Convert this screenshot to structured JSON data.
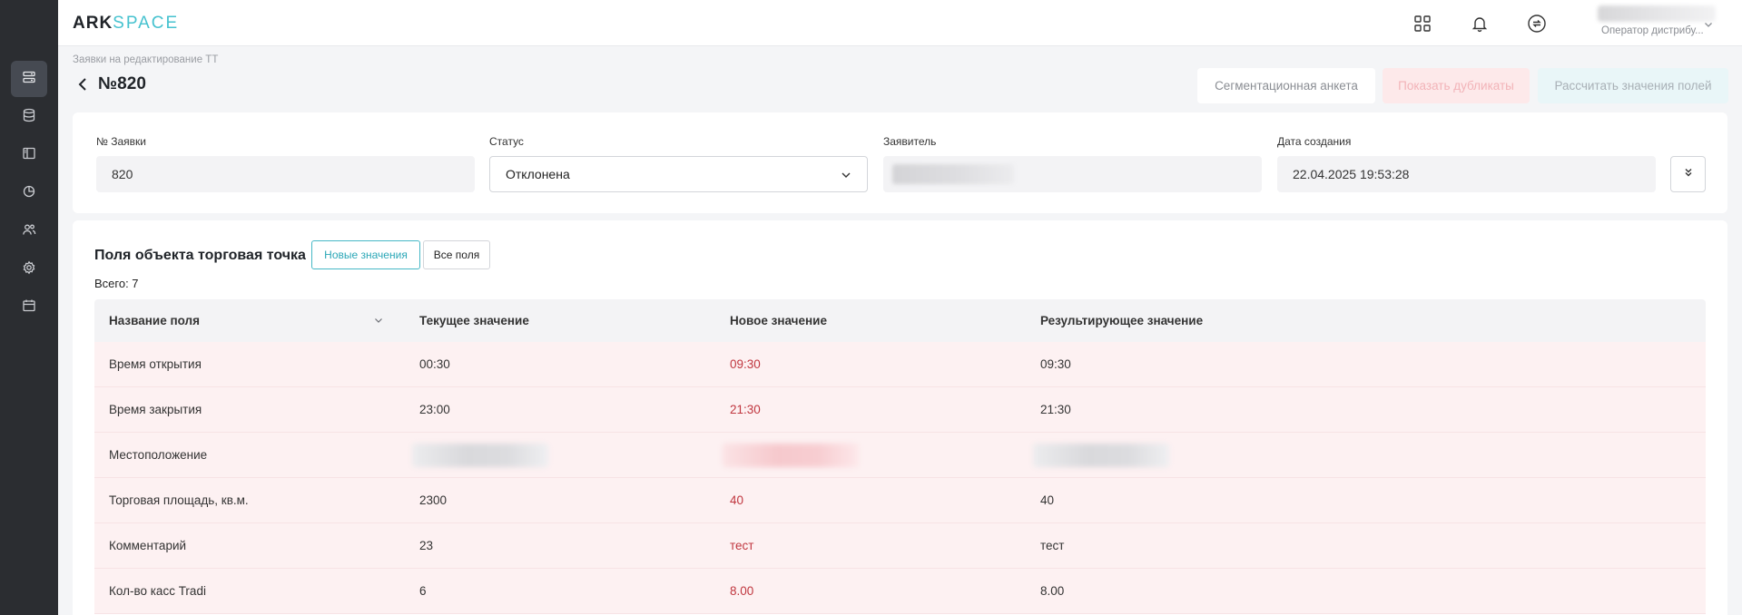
{
  "app": {
    "logo_ark": "ARK",
    "logo_space": "SPACE"
  },
  "sidebar": {
    "items": [
      {
        "icon": "list-icon",
        "active": true
      },
      {
        "icon": "database-icon",
        "active": false
      },
      {
        "icon": "layout-icon",
        "active": false
      },
      {
        "icon": "pie-chart-icon",
        "active": false
      },
      {
        "icon": "users-icon",
        "active": false
      },
      {
        "icon": "settings-icon",
        "active": false
      },
      {
        "icon": "calendar-icon",
        "active": false
      }
    ]
  },
  "header": {
    "icons": [
      "apps-grid-icon",
      "bell-icon",
      "sync-icon"
    ],
    "user_role": "Оператор дистрибу..."
  },
  "page": {
    "breadcrumb": "Заявки на редактирование ТТ",
    "title": "№820",
    "buttons": {
      "segmentation": "Сегментационная анкета",
      "duplicates": "Показать дубликаты",
      "calculate": "Рассчитать значения полей"
    }
  },
  "request": {
    "number_label": "№ Заявки",
    "number_value": "820",
    "status_label": "Статус",
    "status_value": "Отклонена",
    "applicant_label": "Заявитель",
    "created_label": "Дата создания",
    "created_value": "22.04.2025 19:53:28"
  },
  "fields": {
    "title": "Поля объекта торговая точка",
    "toggle_new": "Новые значения",
    "toggle_all": "Все поля",
    "total": "Всего: 7",
    "columns": [
      "Название поля",
      "Текущее значение",
      "Новое значение",
      "Результирующее значение"
    ],
    "rows": [
      {
        "name": "Время открытия",
        "current": "00:30",
        "new": "09:30",
        "result": "09:30"
      },
      {
        "name": "Время закрытия",
        "current": "23:00",
        "new": "21:30",
        "result": "21:30"
      },
      {
        "name": "Местоположение",
        "current": "",
        "new": "",
        "result": "",
        "redacted": true
      },
      {
        "name": "Торговая площадь, кв.м.",
        "current": "2300",
        "new": "40",
        "result": "40"
      },
      {
        "name": "Комментарий",
        "current": "23",
        "new": "тест",
        "result": "тест"
      },
      {
        "name": "Кол-во касс Tradi",
        "current": "6",
        "new": "8.00",
        "result": "8.00"
      }
    ]
  },
  "colors": {
    "accent": "#46c2cf",
    "new_value": "#c0363f",
    "row_bg": "#fdf1f2",
    "sidebar_bg": "#2b2d31"
  }
}
